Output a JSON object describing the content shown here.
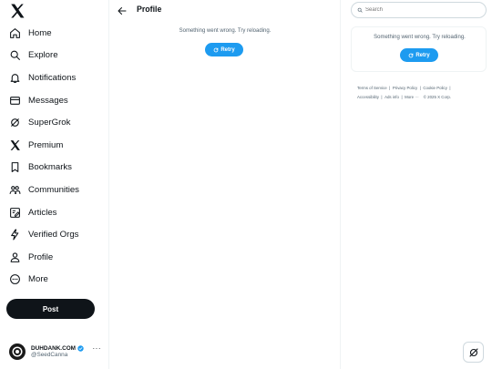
{
  "nav": {
    "items": [
      {
        "label": "Home",
        "icon": "home-icon"
      },
      {
        "label": "Explore",
        "icon": "search-icon"
      },
      {
        "label": "Notifications",
        "icon": "bell-icon"
      },
      {
        "label": "Messages",
        "icon": "envelope-icon"
      },
      {
        "label": "SuperGrok",
        "icon": "grok-icon"
      },
      {
        "label": "Premium",
        "icon": "x-logo-icon"
      },
      {
        "label": "Bookmarks",
        "icon": "bookmark-icon"
      },
      {
        "label": "Communities",
        "icon": "people-icon"
      },
      {
        "label": "Articles",
        "icon": "article-icon"
      },
      {
        "label": "Verified Orgs",
        "icon": "lightning-icon"
      },
      {
        "label": "Profile",
        "icon": "person-icon"
      },
      {
        "label": "More",
        "icon": "more-circle-icon"
      }
    ],
    "post_label": "Post"
  },
  "account": {
    "name": "DUHDANK.COM",
    "handle": "@SeedCanna",
    "more": "···"
  },
  "main": {
    "title": "Profile",
    "error": "Something went wrong. Try reloading.",
    "retry_label": "Retry"
  },
  "right": {
    "search_placeholder": "Search",
    "error": "Something went wrong. Try reloading.",
    "retry_label": "Retry",
    "footer_links": [
      "Terms of Service",
      "Privacy Policy",
      "Cookie Policy",
      "Accessibility",
      "Ads info",
      "More ···"
    ],
    "copyright": "© 2025 X Corp."
  },
  "colors": {
    "accent": "#1d9bf0",
    "text": "#0f1419",
    "muted": "#536471",
    "border": "#eff3f4"
  }
}
